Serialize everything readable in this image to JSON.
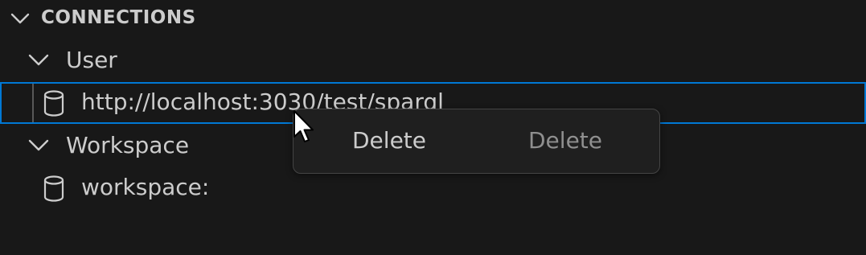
{
  "section": {
    "title": "CONNECTIONS",
    "expand_icon": "chevron-down-icon"
  },
  "groups": [
    {
      "label": "User",
      "expand_icon": "chevron-down-icon",
      "connections": [
        {
          "label": "http://localhost:3030/test/sparql",
          "icon": "database-icon",
          "selected": true
        }
      ]
    },
    {
      "label": "Workspace",
      "expand_icon": "chevron-down-icon",
      "connections": [
        {
          "label": "workspace:",
          "icon": "database-icon",
          "selected": false
        }
      ]
    }
  ],
  "context_menu": {
    "items": [
      {
        "label": "Delete",
        "enabled": true
      },
      {
        "label": "Delete",
        "enabled": false
      }
    ]
  },
  "colors": {
    "background": "#181818",
    "selection_border": "#0078d4",
    "text": "#cccccc",
    "disabled_text": "#8f8f8f",
    "menu_background": "#1f1f1f",
    "menu_border": "#454545"
  }
}
